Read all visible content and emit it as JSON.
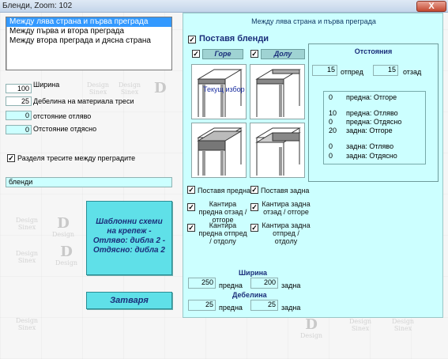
{
  "window": {
    "title": "Бленди, Zoom:  102",
    "close_label": "X"
  },
  "sections_list": {
    "items": [
      "Между лява страна и първа преграда",
      "Между първа и втора преграда",
      "Между втора преграда и дясна страна"
    ]
  },
  "left": {
    "width_value": "100",
    "width_label": "Ширина",
    "thickness_value": "25",
    "thickness_label": "Дебелина на материала треси",
    "offset_left_value": "0",
    "offset_left_label": "отстояние отляво",
    "offset_right_value": "0",
    "offset_right_label": "Отстояние отдясно",
    "split_label": "Разделя тресите между преградите",
    "name_value": "бленди",
    "template_button": "Шаблонни схеми на крепеж   -   Отляво: дибла 2   -   Отдясно: дибла 2",
    "close_button": "Затваря"
  },
  "panel": {
    "title": "Между лява страна и първа преграда",
    "place_label": "Поставя  бленди",
    "top_label": "Горе",
    "bottom_label": "Долу",
    "current_choice": "Текущ избор",
    "distances": {
      "title": "Отстояния",
      "front_value": "15",
      "front_label": "отпред",
      "back_value": "15",
      "back_label": "отзад",
      "rows": [
        {
          "v": "0",
          "t": "предна: Отгоре"
        },
        {
          "v": "10",
          "t": "предна: Отляво"
        },
        {
          "v": "0",
          "t": "предна: Отдясно"
        },
        {
          "v": "20",
          "t": "задна: Отгоре"
        },
        {
          "v": "0",
          "t": "задна: Отляво"
        },
        {
          "v": "0",
          "t": "задна: Отдясно"
        }
      ]
    },
    "checks": {
      "front": "Поставя предна",
      "back": "Поставя задна",
      "edge_front_back": "Кантира предна отзад / отгоре",
      "edge_back_back": "Кантира задна отзад / отгоре",
      "edge_front_front": "Кантира предна отпред / отдолу",
      "edge_back_front": "Кантира задна отпред / отдолу"
    },
    "width_title": "Ширина",
    "front_width": "250",
    "front_width_label": "предна",
    "back_width": "200",
    "back_width_label": "задна",
    "thickness_title": "Дебелина",
    "front_thickness": "25",
    "front_thickness_label": "предна",
    "back_thickness": "25",
    "back_thickness_label": "задна"
  },
  "watermark": {
    "brand": "Design",
    "brand2": "Sinex"
  }
}
